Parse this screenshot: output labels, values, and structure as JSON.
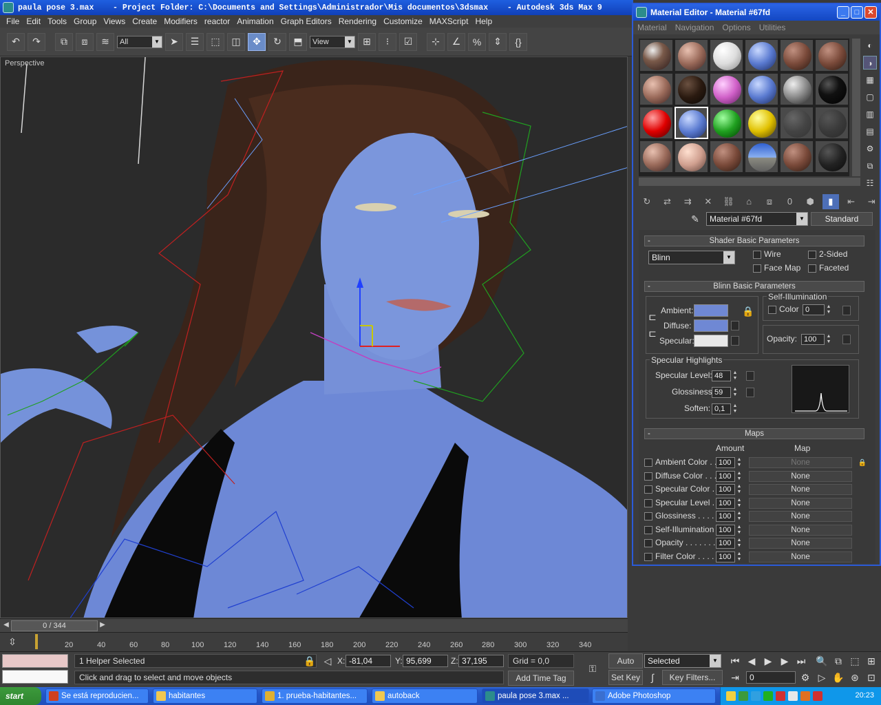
{
  "main_window": {
    "title": "paula pose 3.max    - Project Folder: C:\\Documents and Settings\\Administrador\\Mis documentos\\3dsmax    - Autodesk 3ds Max 9",
    "menus": [
      "File",
      "Edit",
      "Tools",
      "Group",
      "Views",
      "Create",
      "Modifiers",
      "reactor",
      "Animation",
      "Graph Editors",
      "Rendering",
      "Customize",
      "MAXScript",
      "Help"
    ],
    "toolbar": {
      "selection_filter": "All",
      "ref_coord": "View"
    }
  },
  "viewport": {
    "label": "Perspective"
  },
  "timeline": {
    "frame_display": "0 / 344",
    "ticks": [
      "20",
      "40",
      "60",
      "80",
      "100",
      "120",
      "140",
      "160",
      "180",
      "200",
      "220",
      "240",
      "260",
      "280",
      "300",
      "320",
      "340"
    ]
  },
  "status": {
    "selection_info": "1 Helper Selected",
    "prompt": "Click and drag to select and move objects",
    "x_label": "X:",
    "x_value": "-81,04",
    "y_label": "Y:",
    "y_value": "95,699",
    "z_label": "Z:",
    "z_value": "37,195",
    "grid": "Grid = 0,0",
    "add_time_tag": "Add Time Tag",
    "auto_key": "Auto Key",
    "set_key": "Set Key",
    "key_mode": "Selected",
    "key_filters": "Key Filters...",
    "current_frame": "0"
  },
  "material_editor": {
    "title": "Material Editor - Material #67fd",
    "menus": [
      "Material",
      "Navigation",
      "Options",
      "Utilities"
    ],
    "material_name": "Material #67fd",
    "material_type": "Standard",
    "shader_rollout": "Shader Basic Parameters",
    "shader": "Blinn",
    "wire": "Wire",
    "two_sided": "2-Sided",
    "face_map": "Face Map",
    "faceted": "Faceted",
    "blinn_rollout": "Blinn Basic Parameters",
    "self_illum_title": "Self-Illumination",
    "color_label": "Color",
    "self_illum_value": "0",
    "ambient_label": "Ambient:",
    "diffuse_label": "Diffuse:",
    "specular_label": "Specular:",
    "opacity_label": "Opacity:",
    "opacity_value": "100",
    "specular_highlights": "Specular Highlights",
    "spec_level_label": "Specular Level:",
    "spec_level": "48",
    "glossiness_label": "Glossiness:",
    "glossiness": "59",
    "soften_label": "Soften:",
    "soften": "0,1",
    "maps_rollout": "Maps",
    "amount_header": "Amount",
    "map_header": "Map",
    "maps": [
      {
        "name": "Ambient Color . . .",
        "amount": "100",
        "map": "None"
      },
      {
        "name": "Diffuse Color . . . .",
        "amount": "100",
        "map": "None"
      },
      {
        "name": "Specular Color . . .",
        "amount": "100",
        "map": "None"
      },
      {
        "name": "Specular Level . .",
        "amount": "100",
        "map": "None"
      },
      {
        "name": "Glossiness . . . . .",
        "amount": "100",
        "map": "None"
      },
      {
        "name": "Self-Illumination . .",
        "amount": "100",
        "map": "None"
      },
      {
        "name": "Opacity . . . . . . . .",
        "amount": "100",
        "map": "None"
      },
      {
        "name": "Filter Color . . . . .",
        "amount": "100",
        "map": "None"
      }
    ],
    "colors": {
      "ambient": "#6f88d4",
      "diffuse": "#6f88d4",
      "specular": "#e8e8e8"
    }
  },
  "taskbar": {
    "start": "start",
    "tasks": [
      "Se está reproducien...",
      "habitantes",
      "1. prueba-habitantes...",
      "autoback",
      "paula pose 3.max ...",
      "Adobe Photoshop"
    ],
    "clock": "20:23"
  }
}
